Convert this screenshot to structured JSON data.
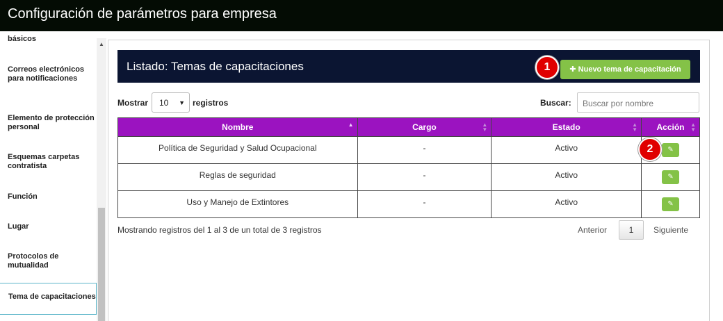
{
  "window": {
    "title": "Configuración de parámetros para empresa"
  },
  "sidebar": {
    "items": [
      {
        "label": "básicos"
      },
      {
        "label": "Correos electrónicos para notificaciones"
      },
      {
        "label": "Elemento de protección personal"
      },
      {
        "label": "Esquemas carpetas contratista"
      },
      {
        "label": "Función"
      },
      {
        "label": "Lugar"
      },
      {
        "label": "Protocolos de mutualidad"
      },
      {
        "label": "Tema de capacitaciones"
      }
    ]
  },
  "panel": {
    "title": "Listado: Temas de capacitaciones",
    "new_button": "✚ Nuevo tema de capacitación"
  },
  "badges": [
    "1",
    "2"
  ],
  "controls": {
    "show_label": "Mostrar",
    "page_size": "10",
    "records_label": "registros",
    "search_label": "Buscar:",
    "search_placeholder": "Buscar por nombre"
  },
  "table": {
    "headers": [
      "Nombre",
      "Cargo",
      "Estado",
      "Acción"
    ],
    "rows": [
      {
        "nombre": "Política de Seguridad y Salud Ocupacional",
        "cargo": "-",
        "estado": "Activo"
      },
      {
        "nombre": "Reglas de seguridad",
        "cargo": "-",
        "estado": "Activo"
      },
      {
        "nombre": "Uso y Manejo de Extintores",
        "cargo": "-",
        "estado": "Activo"
      }
    ]
  },
  "footer": {
    "info": "Mostrando registros del 1 al 3 de un total de 3 registros",
    "prev": "Anterior",
    "page": "1",
    "next": "Siguiente"
  },
  "colors": {
    "header_bg": "#0b1532",
    "table_head": "#9b13c0",
    "button": "#84c247",
    "badge": "#e00000"
  }
}
